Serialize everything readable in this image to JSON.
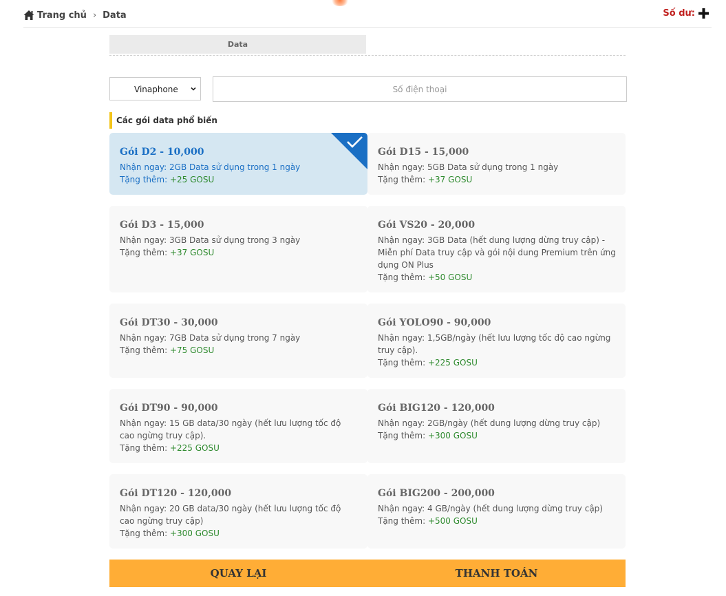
{
  "breadcrumb": {
    "home": "Trang chủ",
    "current": "Data"
  },
  "balance_label": "Số dư:",
  "tab_label": "Data",
  "carrier": {
    "selected": "Vinaphone"
  },
  "phone": {
    "placeholder": "Số điện thoại",
    "value": ""
  },
  "section_title": "Các gói data phổ biến",
  "bonus_label": "Tặng thêm:",
  "packages": [
    {
      "title": "Gói D2 - 10,000",
      "desc": "Nhận ngay: 2GB Data sử dụng trong 1 ngày",
      "bonus": "+25 GOSU",
      "selected": true
    },
    {
      "title": "Gói D15 - 15,000",
      "desc": "Nhận ngay: 5GB Data sử dụng trong 1 ngày",
      "bonus": "+37 GOSU"
    },
    {
      "title": "Gói D3 - 15,000",
      "desc": "Nhận ngay: 3GB Data sử dụng trong 3 ngày",
      "bonus": "+37 GOSU"
    },
    {
      "title": "Gói VS20 - 20,000",
      "desc": "Nhận ngay: 3GB Data (hết dung lượng dừng truy cập) - Miễn phí Data truy cập và gói nội dung Premium trên ứng dụng ON Plus",
      "bonus": "+50 GOSU"
    },
    {
      "title": "Gói DT30 - 30,000",
      "desc": "Nhận ngay: 7GB Data sử dụng trong 7 ngày",
      "bonus": "+75 GOSU"
    },
    {
      "title": "Gói YOLO90 - 90,000",
      "desc": "Nhận ngay: 1,5GB/ngày (hết lưu lượng tốc độ cao ngừng truy cập).",
      "bonus": "+225 GOSU"
    },
    {
      "title": "Gói DT90 - 90,000",
      "desc": "Nhận ngay: 15 GB data/30 ngày (hết lưu lượng tốc độ cao ngừng truy cập).",
      "bonus": "+225 GOSU"
    },
    {
      "title": "Gói BIG120 - 120,000",
      "desc": "Nhận ngay: 2GB/ngày (hết dung lượng dừng truy cập)",
      "bonus": "+300 GOSU"
    },
    {
      "title": "Gói DT120 - 120,000",
      "desc": "Nhận ngay: 20 GB data/30 ngày (hết lưu lượng tốc độ cao ngừng truy cập)",
      "bonus": "+300 GOSU"
    },
    {
      "title": "Gói BIG200 - 200,000",
      "desc": "Nhận ngay: 4 GB/ngày (hết dung lượng dừng truy cập)",
      "bonus": "+500 GOSU"
    }
  ],
  "buttons": {
    "back": "QUAY LẠI",
    "pay": "THANH TOÁN"
  },
  "colors": {
    "accent": "#ffad36",
    "selected_bg": "#d5e7f2",
    "selected_text": "#1a6fc4",
    "bonus": "#2e8a2e",
    "section_bar": "#f3c419",
    "balance": "#c0201e"
  }
}
